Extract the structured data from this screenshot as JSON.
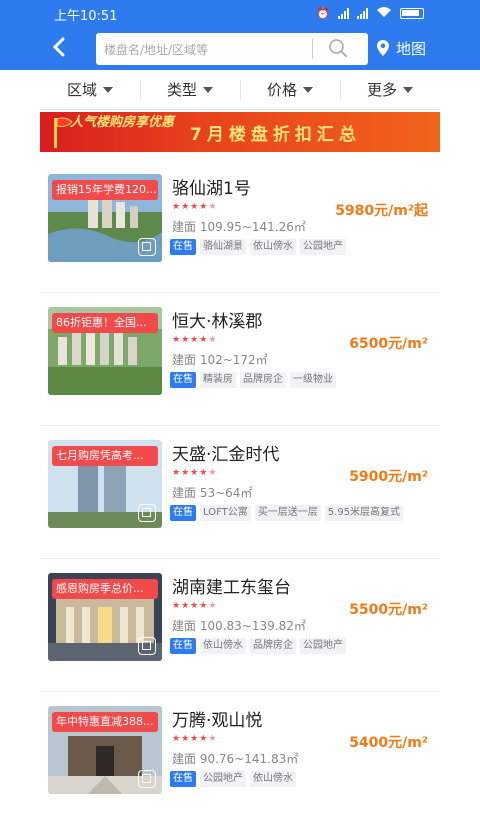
{
  "status_bar": {
    "time": "上午10:51",
    "signal_label_1": "4G",
    "signal_label_2": "4G"
  },
  "header": {
    "search_placeholder": "楼盘名/地址/区域等",
    "map_label": "地图"
  },
  "filters": [
    {
      "label": "区域"
    },
    {
      "label": "类型"
    },
    {
      "label": "价格"
    },
    {
      "label": "更多"
    }
  ],
  "banner": {
    "deco_title": "人气楼购房享优惠",
    "text": "7月楼盘折扣汇总",
    "colors": {
      "bg_start": "#d81e1e",
      "bg_end": "#f0641a",
      "text": "#ffe27a"
    }
  },
  "listings": [
    {
      "promo": "报销15年学费120...",
      "name": "骆仙湖1号",
      "rating": 4.5,
      "area": "建面 109.95~141.26㎡",
      "price": "5980元/m²起",
      "tags": [
        "在售",
        "骆仙湖景",
        "依山傍水",
        "公园地产"
      ]
    },
    {
      "promo": "86折钜惠！全国...",
      "name": "恒大·林溪郡",
      "rating": 4.5,
      "area": "建面 102~172㎡",
      "price": "6500元/m²",
      "tags": [
        "在售",
        "精装房",
        "品牌房企",
        "一级物业"
      ]
    },
    {
      "promo": "七月购房凭高考...",
      "name": "天盛·汇金时代",
      "rating": 4.5,
      "area": "建面 53~64㎡",
      "price": "5900元/m²",
      "tags": [
        "在售",
        "LOFT公寓",
        "买一层送一层",
        "5.95米层高复式"
      ]
    },
    {
      "promo": "感恩购房季总价...",
      "name": "湖南建工东玺台",
      "rating": 4.5,
      "area": "建面 100.83~139.82㎡",
      "price": "5500元/m²",
      "tags": [
        "在售",
        "依山傍水",
        "品牌房企",
        "公园地产"
      ]
    },
    {
      "promo": "年中特惠直减388...",
      "name": "万腾·观山悦",
      "rating": 4.5,
      "area": "建面 90.76~141.83㎡",
      "price": "5400元/m²",
      "tags": [
        "在售",
        "公园地产",
        "依山傍水"
      ]
    }
  ],
  "colors": {
    "primary": "#2e7bf0",
    "price": "#f07a18",
    "promo": "#f04a4a",
    "star": "#f04848"
  }
}
